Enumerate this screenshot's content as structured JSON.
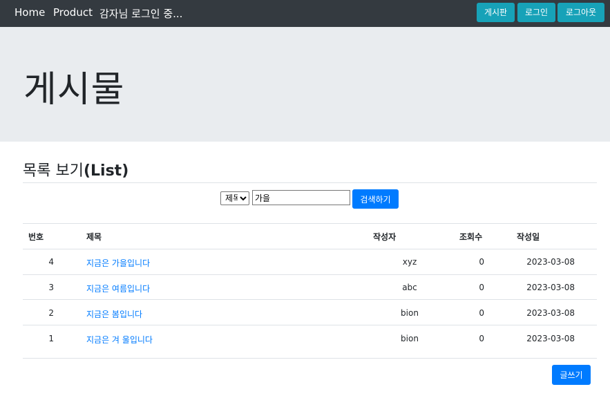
{
  "navbar": {
    "home": "Home",
    "product": "Product",
    "login_status": "감자님 로그인 중...",
    "board_btn": "게시판",
    "login_btn": "로그인",
    "logout_btn": "로그아웃",
    "bg_color": "#343a40",
    "btn_color": "#17a2b8"
  },
  "jumbotron": {
    "title": "게시물"
  },
  "section": {
    "title": "목록 보기",
    "title_suffix": "(List)"
  },
  "search": {
    "select_value": "제목",
    "input_value": "가을",
    "button_label": "검색하기"
  },
  "table": {
    "headers": [
      "번호",
      "제목",
      "작성자",
      "조회수",
      "작성일"
    ],
    "rows": [
      {
        "num": "4",
        "title": "지금은 가을입니다",
        "author": "xyz",
        "views": "0",
        "date": "2023-03-08"
      },
      {
        "num": "3",
        "title": "지금은 여름입니다",
        "author": "abc",
        "views": "0",
        "date": "2023-03-08"
      },
      {
        "num": "2",
        "title": "지금은 봄입니다",
        "author": "bion",
        "views": "0",
        "date": "2023-03-08"
      },
      {
        "num": "1",
        "title": "지금은 겨 울입니다",
        "author": "bion",
        "views": "0",
        "date": "2023-03-08"
      }
    ]
  },
  "write_button": "글쓰기",
  "colors": {
    "primary": "#007bff",
    "info": "#17a2b8",
    "dark": "#343a40",
    "jumbotron_bg": "#e9ecef"
  }
}
